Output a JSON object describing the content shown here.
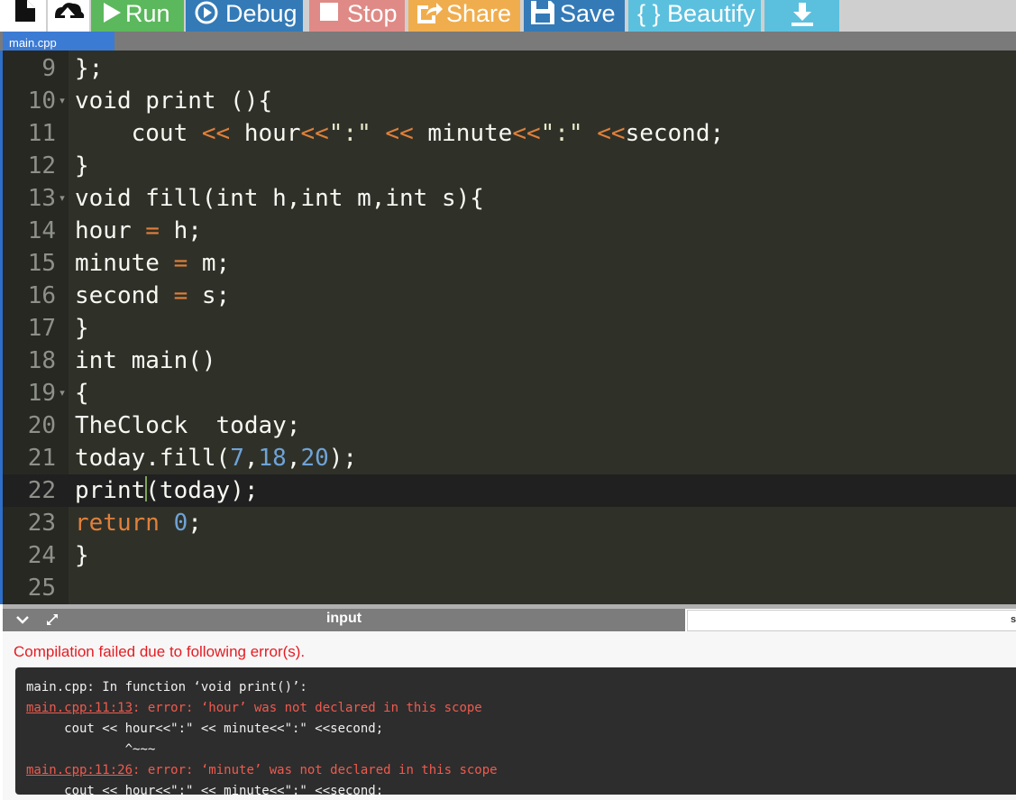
{
  "toolbar": {
    "run_label": "Run",
    "debug_label": "Debug",
    "stop_label": "Stop",
    "share_label": "Share",
    "save_label": "Save",
    "beautify_label": "{ } Beautify"
  },
  "file_tab": {
    "label": "main.cpp"
  },
  "editor": {
    "lines": [
      {
        "num": "9"
      },
      {
        "num": "10"
      },
      {
        "num": "11"
      },
      {
        "num": "12"
      },
      {
        "num": "13"
      },
      {
        "num": "14"
      },
      {
        "num": "15"
      },
      {
        "num": "16"
      },
      {
        "num": "17"
      },
      {
        "num": "18"
      },
      {
        "num": "19"
      },
      {
        "num": "20"
      },
      {
        "num": "21"
      },
      {
        "num": "22"
      },
      {
        "num": "23"
      },
      {
        "num": "24"
      },
      {
        "num": "25"
      }
    ],
    "code": {
      "l9": "};",
      "l10": "void print (){",
      "l11_a": "    cout ",
      "l11_op1": "<<",
      "l11_b": " hour",
      "l11_op2": "<<",
      "l11_str1": "\":\"",
      "l11_c": " ",
      "l11_op3": "<<",
      "l11_d": " minute",
      "l11_op4": "<<",
      "l11_str2": "\":\"",
      "l11_e": " ",
      "l11_op5": "<<",
      "l11_f": "second;",
      "l12": "}",
      "l13": "void fill(int h,int m,int s){",
      "l14_a": "hour ",
      "l14_op": "=",
      "l14_b": " h;",
      "l15_a": "minute ",
      "l15_op": "=",
      "l15_b": " m;",
      "l16_a": "second ",
      "l16_op": "=",
      "l16_b": " s;",
      "l17": "}",
      "l18": "int main()",
      "l19": "{",
      "l20": "TheClock  today;",
      "l21_a": "today.fill(",
      "l21_n1": "7",
      "l21_c1": ",",
      "l21_n2": "18",
      "l21_c2": ",",
      "l21_n3": "20",
      "l21_b": ");",
      "l22_a": "print",
      "l22_b": "(today);",
      "l23_kw": "return",
      "l23_sp": " ",
      "l23_n": "0",
      "l23_b": ";",
      "l24": "}",
      "l25": ""
    }
  },
  "panel": {
    "title": "input",
    "right_cut_text": "s"
  },
  "output": {
    "compile_message": "Compilation failed due to following error(s).",
    "errors": {
      "e1": "main.cpp: In function ‘void print()’:",
      "e2_loc": "main.cpp:11:13",
      "e2_msg": ": error: ‘hour’ was not declared in this scope",
      "e3": "     cout << hour<<\":\" << minute<<\":\" <<second;",
      "e4": "             ^~~~",
      "e5_loc": "main.cpp:11:26",
      "e5_msg": ": error: ‘minute’ was not declared in this scope",
      "e6": "     cout << hour<<\":\" << minute<<\":\" <<second;"
    }
  },
  "colors": {
    "run": "#5cb85c",
    "debug": "#337ab7",
    "stop": "#df8a86",
    "share": "#f0ad4e",
    "beautify": "#5bc0de",
    "editor_bg": "#2f3129",
    "error_red": "#e51c23"
  }
}
